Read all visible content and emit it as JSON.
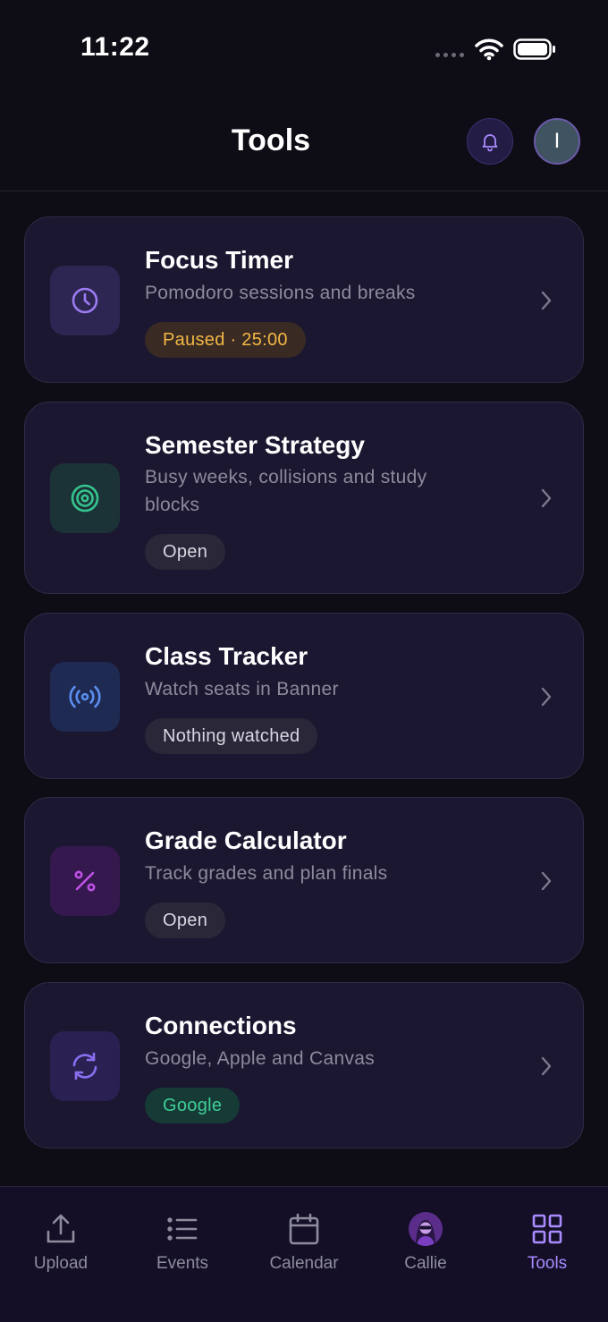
{
  "status_bar": {
    "time": "11:22"
  },
  "header": {
    "title": "Tools",
    "avatar_initial": "I"
  },
  "cards": [
    {
      "title": "Focus Timer",
      "description": "Pomodoro sessions and breaks",
      "badge": "Paused · 25:00",
      "icon": "clock-icon",
      "accent": "#9b7cf2",
      "badge_color": "#f2b845"
    },
    {
      "title": "Semester Strategy",
      "description": "Busy weeks, collisions and study blocks",
      "badge": "Open",
      "icon": "target-icon",
      "accent": "#35c58f",
      "badge_color": "#d9d7e2"
    },
    {
      "title": "Class Tracker",
      "description": "Watch seats in Banner",
      "badge": "Nothing watched",
      "icon": "broadcast-icon",
      "accent": "#5b8ef0",
      "badge_color": "#d9d7e2"
    },
    {
      "title": "Grade Calculator",
      "description": "Track grades and plan finals",
      "badge": "Open",
      "icon": "percent-icon",
      "accent": "#c052e8",
      "badge_color": "#d9d7e2"
    },
    {
      "title": "Connections",
      "description": "Google, Apple and Canvas",
      "badge": "Google",
      "icon": "sync-icon",
      "accent": "#8a6ef0",
      "badge_color": "#3fcf95"
    }
  ],
  "nav": {
    "items": [
      {
        "label": "Upload",
        "icon": "upload-icon"
      },
      {
        "label": "Events",
        "icon": "list-icon"
      },
      {
        "label": "Calendar",
        "icon": "calendar-icon"
      },
      {
        "label": "Callie",
        "icon": "callie-avatar-icon"
      },
      {
        "label": "Tools",
        "icon": "grid-icon",
        "active": true
      }
    ]
  },
  "colors": {
    "background": "#0e0d16",
    "card": "#1b1730",
    "accent": "#a98bff"
  }
}
